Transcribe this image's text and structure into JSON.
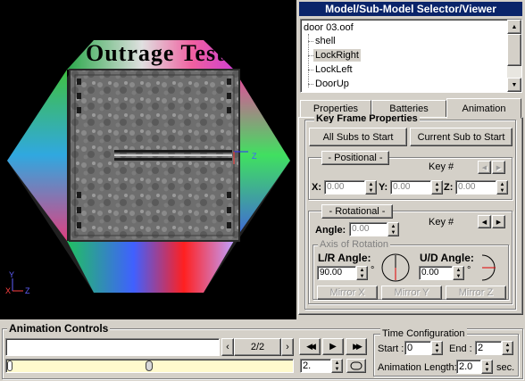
{
  "viewport": {
    "outrage_text": "Outrage Test",
    "axis_y": "Y",
    "axis_z": "Z",
    "axis_x": "X"
  },
  "selector": {
    "title": "Model/Sub-Model Selector/Viewer",
    "items": [
      "door 03.oof",
      "shell",
      "LockRight",
      "LockLeft",
      "DoorUp"
    ],
    "selected": "LockRight"
  },
  "tabs": [
    "Properties",
    "Batteries",
    "Animation"
  ],
  "active_tab": "Animation",
  "keyframe": {
    "group_label": "Key Frame Properties",
    "all_subs_button": "All Subs to Start",
    "current_sub_button": "Current Sub to Start"
  },
  "positional": {
    "group_label": "- Positional -",
    "key_label": "Key #",
    "x_label": "X:",
    "x_value": "0.00",
    "y_label": "Y:",
    "y_value": "0.00",
    "z_label": "Z:",
    "z_value": "0.00"
  },
  "rotational": {
    "group_label": "- Rotational -",
    "key_label": "Key #",
    "angle_label": "Angle:",
    "angle_value": "0.00",
    "axis_group": "Axis of Rotation",
    "lr_label": "L/R Angle:",
    "lr_value": "90.00",
    "ud_label": "U/D Angle:",
    "ud_value": "0.00",
    "degree": "°",
    "mirror_x": "Mirror X",
    "mirror_y": "Mirror Y",
    "mirror_z": "Mirror Z"
  },
  "animation_controls": {
    "title": "Animation Controls",
    "frame_counter": "2/2",
    "frame_field": "2.",
    "slider_fraction": 0.5,
    "prev_arrow": "‹",
    "next_arrow": "›"
  },
  "time_config": {
    "title": "Time Configuration",
    "start_label": "Start :",
    "start_value": "0",
    "end_label": "End :",
    "end_value": "2",
    "length_label": "Animation Length:",
    "length_value": "2.0",
    "sec_label": "sec."
  }
}
